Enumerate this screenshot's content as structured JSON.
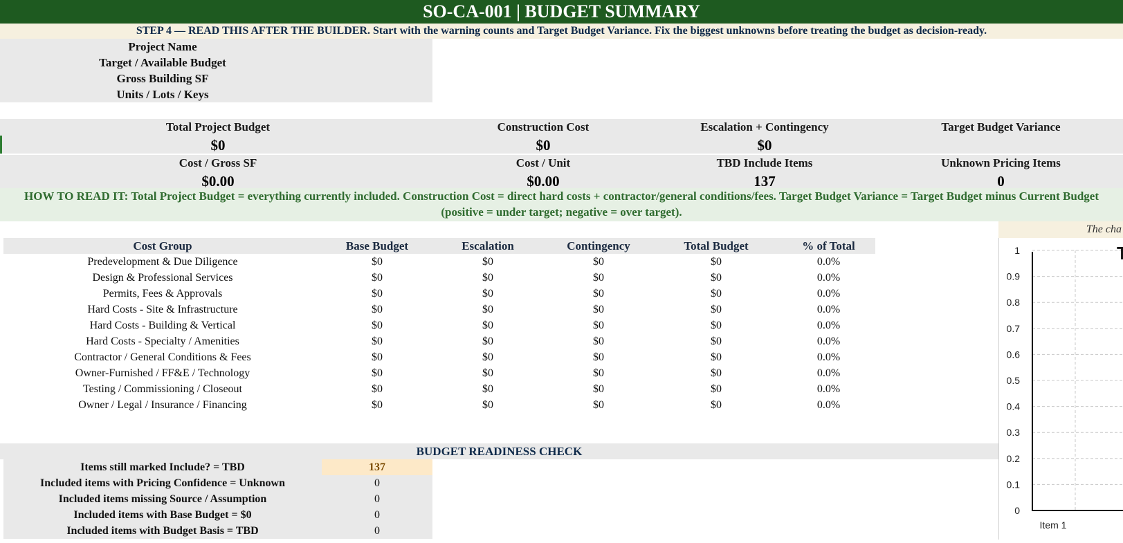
{
  "title": "SO-CA-001 | BUDGET SUMMARY",
  "step_note": "STEP 4 — READ THIS AFTER THE BUILDER. Start with the warning counts and Target Budget Variance. Fix the biggest unknowns before treating the budget as decision-ready.",
  "project_info": {
    "labels": [
      "Project Name",
      "Target / Available Budget",
      "Gross Building SF",
      "Units / Lots / Keys"
    ]
  },
  "kpis": {
    "row1": {
      "headers": [
        "Total Project Budget",
        "Construction Cost",
        "Escalation + Contingency",
        "Target Budget Variance"
      ],
      "values": [
        "$0",
        "$0",
        "$0",
        ""
      ]
    },
    "row2": {
      "headers": [
        "Cost / Gross SF",
        "Cost / Unit",
        "TBD Include Items",
        "Unknown Pricing Items"
      ],
      "values": [
        "$0.00",
        "$0.00",
        "137",
        "0"
      ]
    }
  },
  "how_to_read": "HOW TO READ IT: Total Project Budget = everything currently included. Construction Cost = direct hard costs + contractor/general conditions/fees. Target Budget Variance = Target Budget minus Current Budget (positive = under target; negative = over target).",
  "cost_table": {
    "headers": [
      "Cost Group",
      "Base Budget",
      "Escalation",
      "Contingency",
      "Total Budget",
      "% of Total"
    ],
    "rows": [
      [
        "Predevelopment & Due Diligence",
        "$0",
        "$0",
        "$0",
        "$0",
        "0.0%"
      ],
      [
        "Design & Professional Services",
        "$0",
        "$0",
        "$0",
        "$0",
        "0.0%"
      ],
      [
        "Permits, Fees & Approvals",
        "$0",
        "$0",
        "$0",
        "$0",
        "0.0%"
      ],
      [
        "Hard Costs - Site & Infrastructure",
        "$0",
        "$0",
        "$0",
        "$0",
        "0.0%"
      ],
      [
        "Hard Costs - Building & Vertical",
        "$0",
        "$0",
        "$0",
        "$0",
        "0.0%"
      ],
      [
        "Hard Costs - Specialty / Amenities",
        "$0",
        "$0",
        "$0",
        "$0",
        "0.0%"
      ],
      [
        "Contractor / General Conditions & Fees",
        "$0",
        "$0",
        "$0",
        "$0",
        "0.0%"
      ],
      [
        "Owner-Furnished / FF&E / Technology",
        "$0",
        "$0",
        "$0",
        "$0",
        "0.0%"
      ],
      [
        "Testing / Commissioning / Closeout",
        "$0",
        "$0",
        "$0",
        "$0",
        "0.0%"
      ],
      [
        "Owner / Legal / Insurance / Financing",
        "$0",
        "$0",
        "$0",
        "$0",
        "0.0%"
      ]
    ]
  },
  "readiness": {
    "title": "BUDGET READINESS CHECK",
    "items": [
      {
        "label": "Items still marked Include? = TBD",
        "value": "137",
        "highlight": true
      },
      {
        "label": "Included items with Pricing Confidence = Unknown",
        "value": "0",
        "highlight": false
      },
      {
        "label": "Included items missing Source / Assumption",
        "value": "0",
        "highlight": false
      },
      {
        "label": "Included items with Base Budget = $0",
        "value": "0",
        "highlight": false
      },
      {
        "label": "Included items with Budget Basis = TBD",
        "value": "0",
        "highlight": false
      }
    ]
  },
  "chart_banner": "The cha",
  "chart_data": {
    "type": "bar",
    "categories": [
      "Item 1"
    ],
    "values": [
      0
    ],
    "title": "T",
    "ylim": [
      0,
      1
    ],
    "yticks": [
      "1",
      "0.9",
      "0.8",
      "0.7",
      "0.6",
      "0.5",
      "0.4",
      "0.3",
      "0.2",
      "0.1",
      "0"
    ],
    "grid": true
  },
  "colors": {
    "title_bg": "#1e5a20",
    "step_bg": "#f6f0df",
    "howto_bg": "#e6f0e4",
    "howto_text": "#2f6b2f",
    "highlight_bg": "#fde9c8",
    "highlight_text": "#7a4a00"
  }
}
